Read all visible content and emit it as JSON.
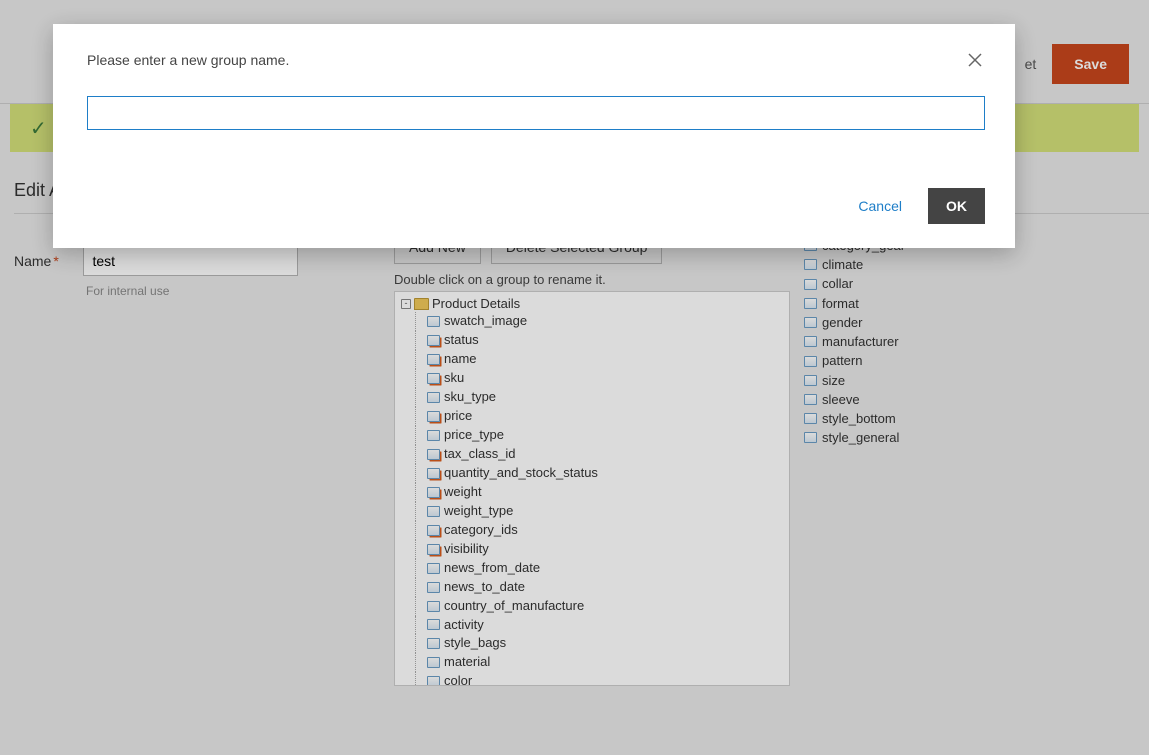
{
  "topbar": {
    "back_text": "et",
    "save_label": "Save"
  },
  "success": {
    "visible": true
  },
  "section_title": "Edit A",
  "name_field": {
    "label": "Name",
    "value": "test",
    "helper": "For internal use"
  },
  "groups": {
    "add_label": "Add New",
    "delete_label": "Delete Selected Group",
    "hint": "Double click on a group to rename it.",
    "folder": "Product Details",
    "items": [
      {
        "name": "swatch_image",
        "required": false
      },
      {
        "name": "status",
        "required": true
      },
      {
        "name": "name",
        "required": true
      },
      {
        "name": "sku",
        "required": true
      },
      {
        "name": "sku_type",
        "required": false
      },
      {
        "name": "price",
        "required": true
      },
      {
        "name": "price_type",
        "required": false
      },
      {
        "name": "tax_class_id",
        "required": true
      },
      {
        "name": "quantity_and_stock_status",
        "required": true
      },
      {
        "name": "weight",
        "required": true
      },
      {
        "name": "weight_type",
        "required": false
      },
      {
        "name": "category_ids",
        "required": true
      },
      {
        "name": "visibility",
        "required": true
      },
      {
        "name": "news_from_date",
        "required": false
      },
      {
        "name": "news_to_date",
        "required": false
      },
      {
        "name": "country_of_manufacture",
        "required": false
      },
      {
        "name": "activity",
        "required": false
      },
      {
        "name": "style_bags",
        "required": false
      },
      {
        "name": "material",
        "required": false
      },
      {
        "name": "color",
        "required": false
      }
    ]
  },
  "unassigned": [
    "category_gear",
    "climate",
    "collar",
    "format",
    "gender",
    "manufacturer",
    "pattern",
    "size",
    "sleeve",
    "style_bottom",
    "style_general"
  ],
  "modal": {
    "title": "Please enter a new group name.",
    "input_value": "",
    "cancel_label": "Cancel",
    "ok_label": "OK"
  }
}
